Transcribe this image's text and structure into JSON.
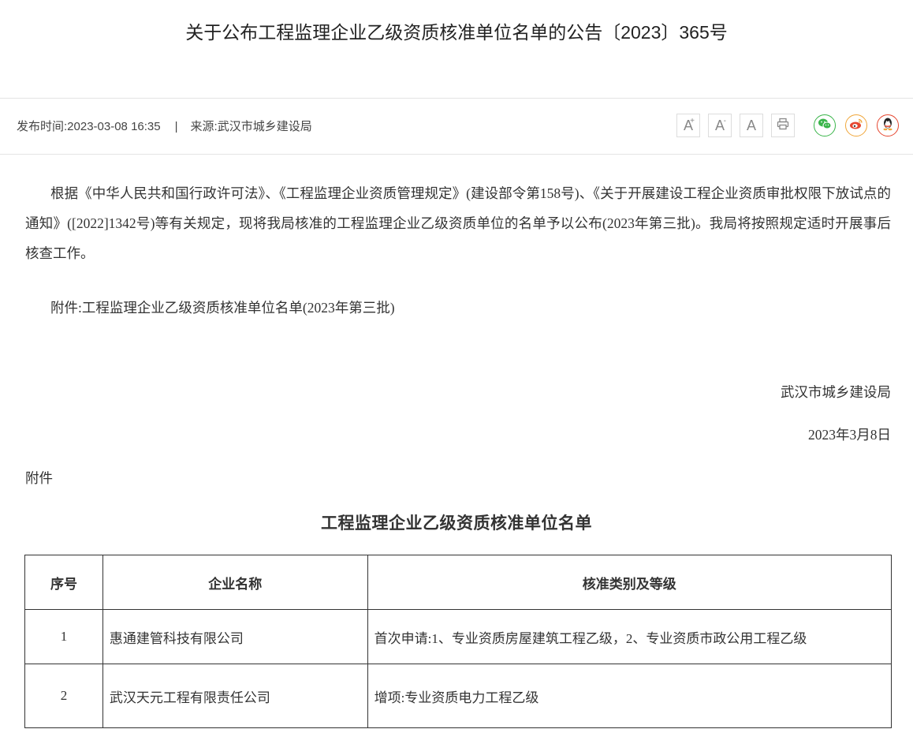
{
  "article": {
    "title": "关于公布工程监理企业乙级资质核准单位名单的公告〔2023〕365号",
    "publish_label": "发布时间:",
    "publish_time": "2023-03-08 16:35",
    "separator": "|",
    "source_label": "来源:",
    "source": "武汉市城乡建设局"
  },
  "toolbar": {
    "font_increase": "A",
    "font_increase_mark": "+",
    "font_decrease": "A",
    "font_decrease_mark": "-",
    "font_reset": "A",
    "icons": [
      "print-icon",
      "wechat-icon",
      "weibo-icon",
      "qq-icon"
    ],
    "colors": {
      "wechat": "#3ab54a",
      "weibo": "#f0a63a",
      "qq": "#e6462f"
    }
  },
  "content": {
    "paragraph1": "根据《中华人民共和国行政许可法》、《工程监理企业资质管理规定》(建设部令第158号)、《关于开展建设工程企业资质审批权限下放试点的通知》([2022]1342号)等有关规定，现将我局核准的工程监理企业乙级资质单位的名单予以公布(2023年第三批)。我局将按照规定适时开展事后核查工作。",
    "paragraph2": "附件:工程监理企业乙级资质核准单位名单(2023年第三批)",
    "signature": "武汉市城乡建设局",
    "date": "2023年3月8日",
    "attachment_label": "附件"
  },
  "table": {
    "title": "工程监理企业乙级资质核准单位名单",
    "headers": [
      "序号",
      "企业名称",
      "核准类别及等级"
    ],
    "rows": [
      [
        "1",
        "惠通建管科技有限公司",
        "首次申请:1、专业资质房屋建筑工程乙级，2、专业资质市政公用工程乙级"
      ],
      [
        "2",
        "武汉天元工程有限责任公司",
        "增项:专业资质电力工程乙级"
      ]
    ]
  }
}
